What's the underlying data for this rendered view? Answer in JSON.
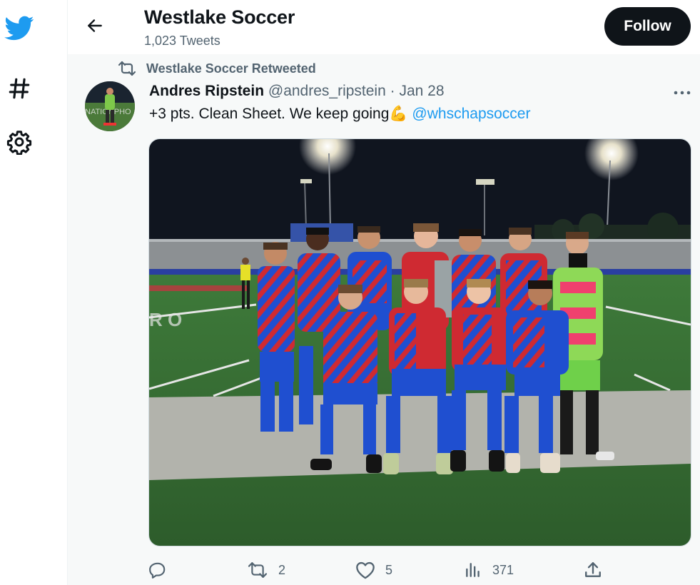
{
  "sidebar": {
    "icons": [
      "twitter-logo-icon",
      "hashtag-icon",
      "gear-icon"
    ]
  },
  "header": {
    "title": "Westlake Soccer",
    "subtitle": "1,023 Tweets",
    "follow_label": "Follow"
  },
  "tweet": {
    "retweet_notice": "Westlake Soccer Retweeted",
    "author_name": "Andres Ripstein",
    "handle": "@andres_ripstein",
    "separator": "·",
    "date": "Jan 28",
    "text": "+3 pts. Clean Sheet. We keep going",
    "emoji": "💪",
    "mention": "@whschapsoccer",
    "media": "team photo on soccer field at night",
    "avatar": "player photo avatar",
    "colors": {
      "accent": "#1d9bf0",
      "muted": "#536471",
      "dark": "#0f1419"
    }
  },
  "actions": {
    "reply_count": "",
    "retweet_count": "2",
    "like_count": "5",
    "views_count": "371"
  }
}
